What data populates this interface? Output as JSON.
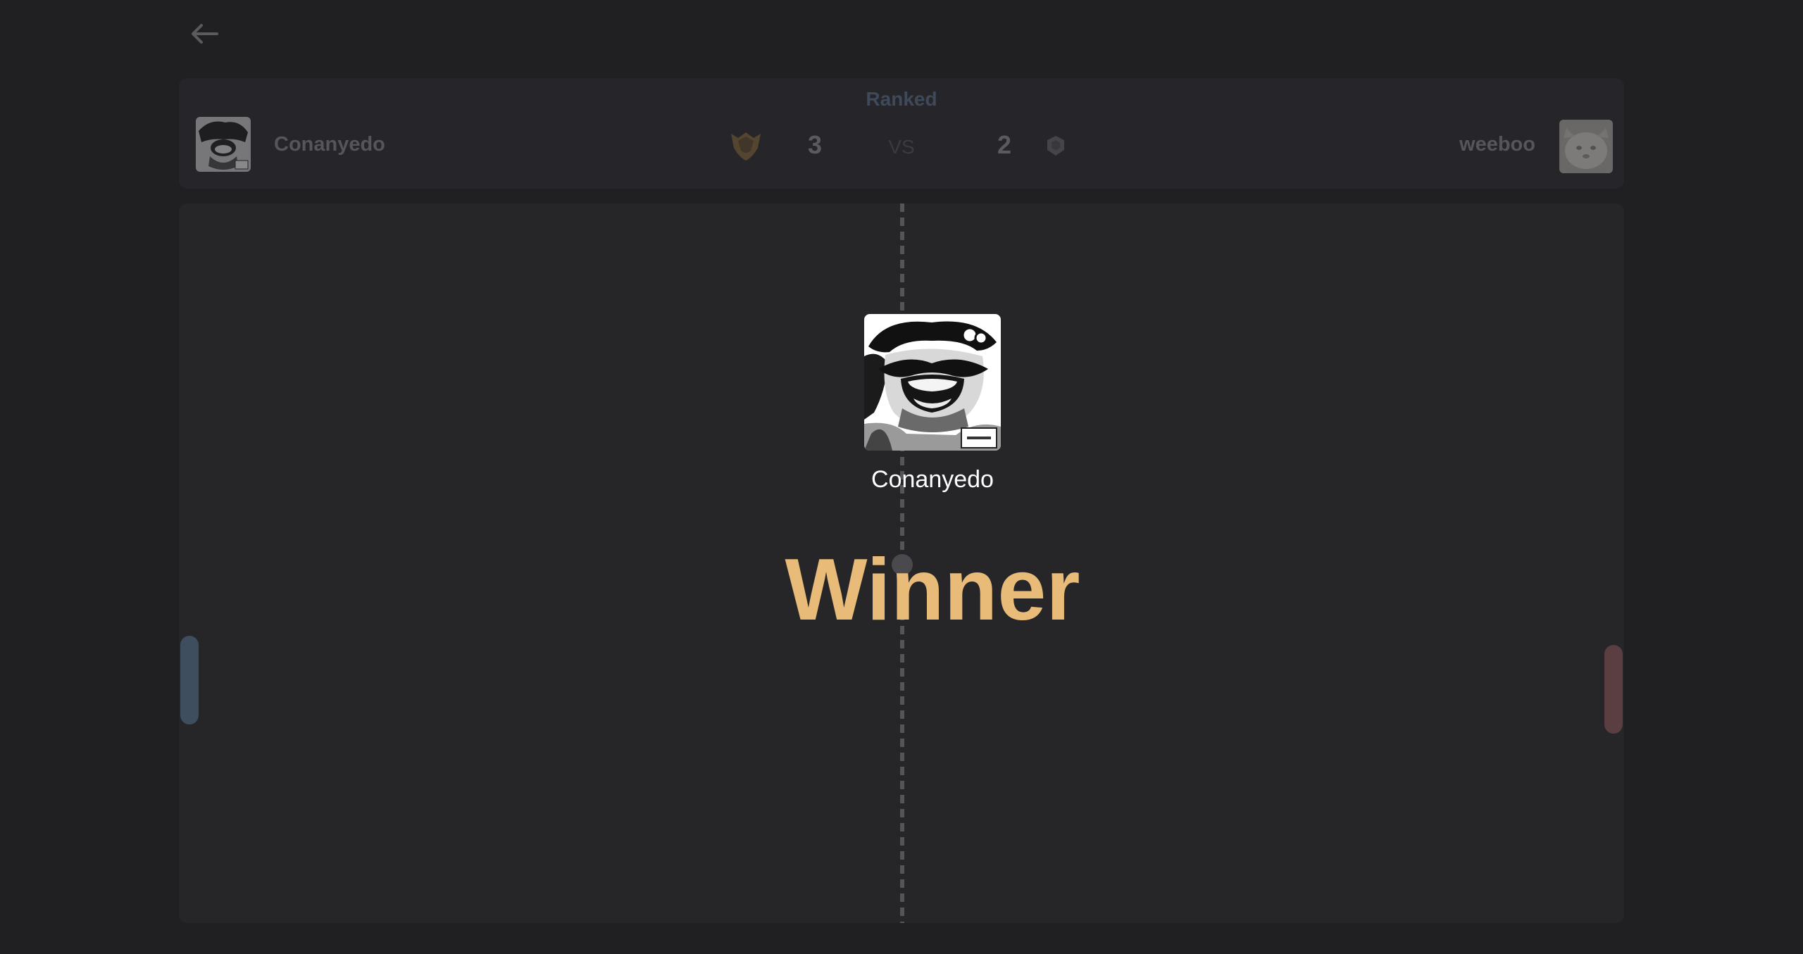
{
  "nav": {
    "back_icon": "arrow-left-icon"
  },
  "match": {
    "mode": "Ranked",
    "vs": "VS",
    "left_player": {
      "name": "Conanyedo",
      "score": "3",
      "rank_icon": "rank-badge-icon"
    },
    "right_player": {
      "name": "weeboo",
      "score": "2",
      "rank_icon": "rank-badge-icon"
    }
  },
  "result": {
    "winner_name": "Conanyedo",
    "title": "Winner"
  },
  "colors": {
    "background": "#202023",
    "panel": "#26262a",
    "winner_accent": "#e8bb79",
    "left_paddle": "#3e4e5e",
    "right_paddle": "#5a3e42"
  }
}
